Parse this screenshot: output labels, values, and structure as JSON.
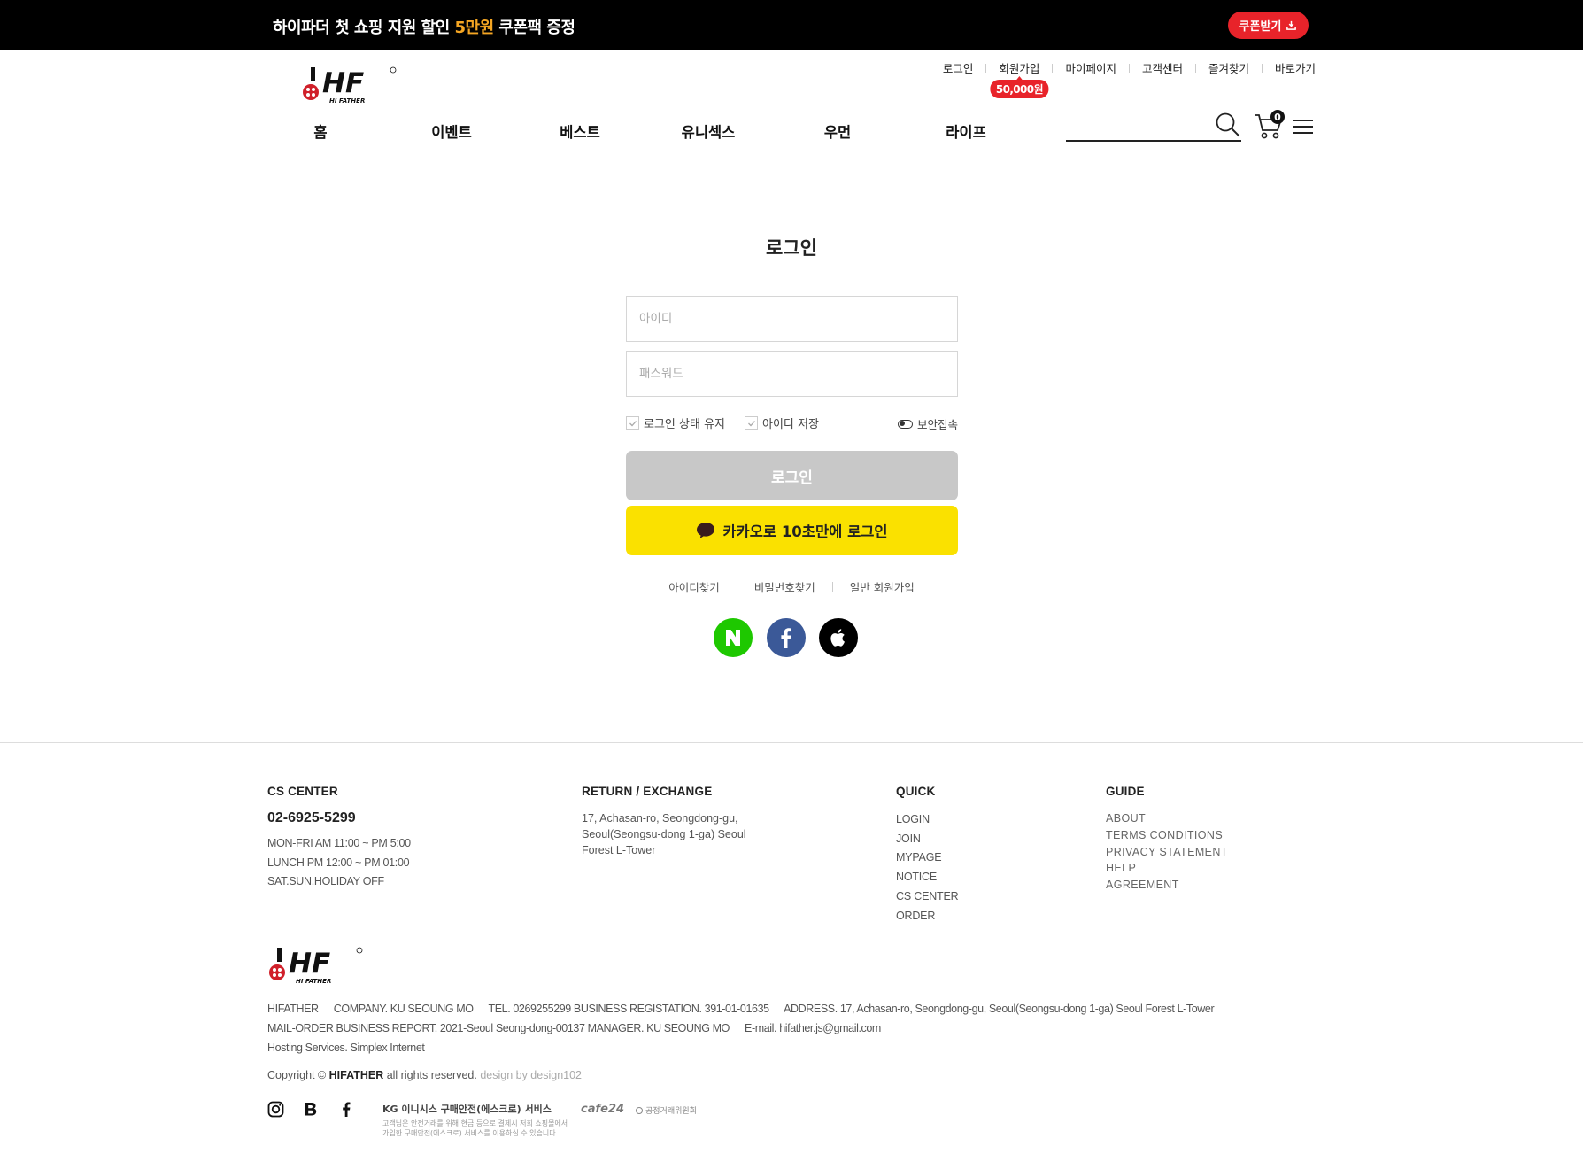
{
  "banner": {
    "text_before": "하이파더 첫 쇼핑 지원 할인 ",
    "highlight": "5만원",
    "text_after": " 쿠폰팩 증정",
    "coupon_button": "쿠폰받기",
    "highlight_color": "#f5a623"
  },
  "header": {
    "logo": "HF",
    "logo_sub": "HI FATHER",
    "util_nav": [
      "로그인",
      "회원가입",
      "마이페이지",
      "고객센터",
      "즐겨찾기",
      "바로가기"
    ],
    "join_badge": "50,000원",
    "main_nav": [
      "홈",
      "이벤트",
      "베스트",
      "유니섹스",
      "우먼",
      "라이프"
    ],
    "search_placeholder": "",
    "cart_count": "0",
    "accent_color": "#e8232a"
  },
  "login": {
    "title": "로그인",
    "id_placeholder": "아이디",
    "pw_placeholder": "패스워드",
    "keep_login": "로그인 상태 유지",
    "save_id": "아이디 저장",
    "secure_login": "보안접속",
    "login_button": "로그인",
    "kakao_button": "카카오로 10초만에 로그인",
    "kakao_color": "#fae100",
    "links": [
      "아이디찾기",
      "비밀번호찾기",
      "일반 회원가입"
    ],
    "sns": [
      "naver-icon",
      "facebook-icon",
      "apple-icon"
    ]
  },
  "footer": {
    "cs": {
      "title": "CS CENTER",
      "phone": "02-6925-5299",
      "hours": [
        "MON-FRI AM 11:00 ~ PM 5:00",
        "LUNCH PM 12:00 ~ PM 01:00",
        "SAT.SUN.HOLIDAY OFF"
      ]
    },
    "return": {
      "title": "RETURN / EXCHANGE",
      "address": "17, Achasan-ro, Seongdong-gu, Seoul(Seongsu-dong 1-ga) Seoul Forest L-Tower"
    },
    "quick": {
      "title": "QUICK",
      "links": [
        "LOGIN",
        "JOIN",
        "MYPAGE",
        "NOTICE",
        "CS CENTER",
        "ORDER"
      ]
    },
    "guide": {
      "title": "GUIDE",
      "links": [
        "ABOUT",
        "TERMS CONDITIONS",
        "PRIVACY STATEMENT",
        "HELP",
        "AGREEMENT"
      ]
    },
    "info": {
      "row1": [
        "HIFATHER",
        "COMPANY. KU SEOUNG MO",
        "TEL. 0269255299 BUSINESS REGISTATION. 391-01-01635",
        "ADDRESS. 17, Achasan-ro, Seongdong-gu, Seoul(Seongsu-dong 1-ga) Seoul Forest L-Tower"
      ],
      "row2": [
        "MAIL-ORDER BUSINESS REPORT. 2021-Seoul Seong-dong-00137 MANAGER. KU SEOUNG MO",
        "E-mail. hifather.js@gmail.com"
      ],
      "row3": "Hosting Services. Simplex Internet"
    },
    "copyright_prefix": "Copyright © ",
    "copyright_brand": "HIFATHER",
    "copyright_suffix": " all rights reserved.",
    "design_credit": "design by design102",
    "social_icons": [
      "instagram-icon",
      "blog-icon",
      "facebook-icon"
    ],
    "kg_title": "KG 이니시스 구매안전(에스크로) 서비스",
    "kg_desc": "고객님은 안전거래를 위해 현금 등으로 결제시 저희 쇼핑몰에서 가입한 구매안전(에스크로) 서비스를 이용하실 수 있습니다.",
    "cafe24": "cafe24",
    "ftc": "공정거래위원회"
  }
}
